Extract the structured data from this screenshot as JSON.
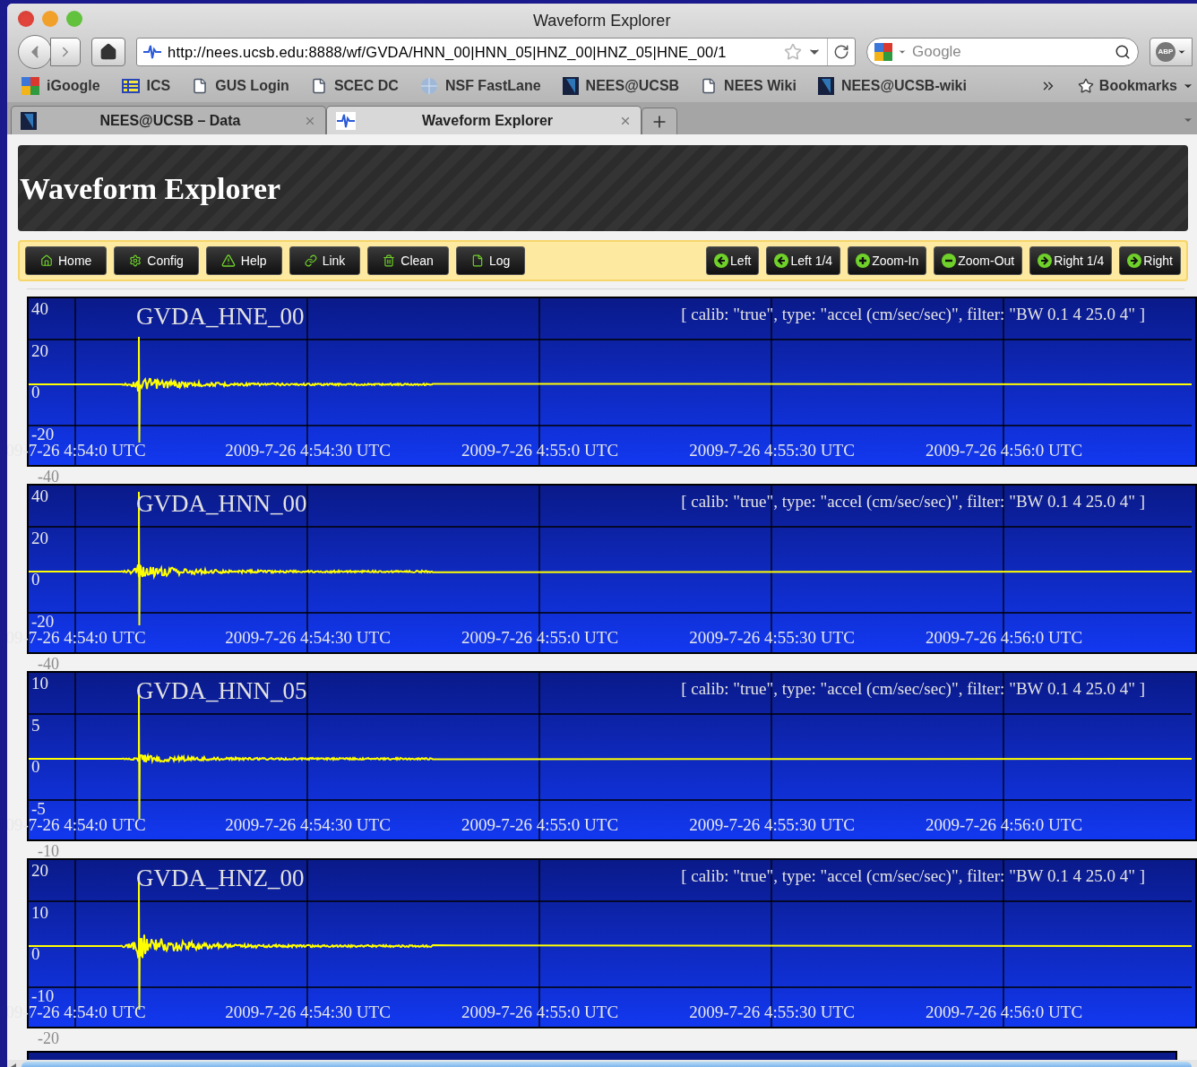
{
  "window": {
    "title": "Waveform Explorer"
  },
  "address_bar": {
    "url": "http://nees.ucsb.edu:8888/wf/GVDA/HNN_00|HNN_05|HNZ_00|HNZ_05|HNE_00/1"
  },
  "search": {
    "placeholder": "Google"
  },
  "abp": {
    "label": "ABP"
  },
  "bookmarks": [
    {
      "label": "iGoogle",
      "kind": "google"
    },
    {
      "label": "ICS",
      "kind": "ics"
    },
    {
      "label": "GUS Login",
      "kind": "page"
    },
    {
      "label": "SCEC DC",
      "kind": "page"
    },
    {
      "label": "NSF FastLane",
      "kind": "globe"
    },
    {
      "label": "NEES@UCSB",
      "kind": "nees"
    },
    {
      "label": "NEES Wiki",
      "kind": "page"
    },
    {
      "label": "NEES@UCSB-wiki",
      "kind": "nees"
    }
  ],
  "bookmarks_menu": {
    "label": "Bookmarks"
  },
  "tabs": [
    {
      "label": "NEES@UCSB – Data",
      "selected": false,
      "kind": "nees"
    },
    {
      "label": "Waveform Explorer",
      "selected": true,
      "kind": "wave"
    }
  ],
  "page": {
    "title": "Waveform Explorer",
    "toolbar_left": [
      {
        "label": "Home",
        "kind": "home"
      },
      {
        "label": "Config",
        "kind": "gear"
      },
      {
        "label": "Help",
        "kind": "warning"
      },
      {
        "label": "Link",
        "kind": "link"
      },
      {
        "label": "Clean",
        "kind": "trash"
      },
      {
        "label": "Log",
        "kind": "page"
      }
    ],
    "toolbar_right": [
      {
        "label": "Left",
        "kind": "left"
      },
      {
        "label": "Left 1/4",
        "kind": "left"
      },
      {
        "label": "Zoom-In",
        "kind": "plus"
      },
      {
        "label": "Zoom-Out",
        "kind": "minus"
      },
      {
        "label": "Right 1/4",
        "kind": "right"
      },
      {
        "label": "Right",
        "kind": "right"
      }
    ],
    "plots": [
      {
        "channel": "GVDA_HNE_00",
        "info": "[ calib: \"true\", type: \"accel (cm/sec/sec)\", filter: \"BW 0.1 4 25.0 4\" ]",
        "y_labels": [
          "40",
          "20",
          "0",
          "-20"
        ],
        "y_below": "-40",
        "x_labels": [
          "09-7-26 4:54:0 UTC",
          "2009-7-26 4:54:30 UTC",
          "2009-7-26 4:55:0 UTC",
          "2009-7-26 4:55:30 UTC",
          "2009-7-26 4:56:0 UTC"
        ]
      },
      {
        "channel": "GVDA_HNN_00",
        "info": "[ calib: \"true\", type: \"accel (cm/sec/sec)\", filter: \"BW 0.1 4 25.0 4\" ]",
        "y_labels": [
          "40",
          "20",
          "0",
          "-20"
        ],
        "y_below": "-40",
        "x_labels": [
          "09-7-26 4:54:0 UTC",
          "2009-7-26 4:54:30 UTC",
          "2009-7-26 4:55:0 UTC",
          "2009-7-26 4:55:30 UTC",
          "2009-7-26 4:56:0 UTC"
        ]
      },
      {
        "channel": "GVDA_HNN_05",
        "info": "[ calib: \"true\", type: \"accel (cm/sec/sec)\", filter: \"BW 0.1 4 25.0 4\" ]",
        "y_labels": [
          "10",
          "5",
          "0",
          "-5"
        ],
        "y_below": "-10",
        "x_labels": [
          "09-7-26 4:54:0 UTC",
          "2009-7-26 4:54:30 UTC",
          "2009-7-26 4:55:0 UTC",
          "2009-7-26 4:55:30 UTC",
          "2009-7-26 4:56:0 UTC"
        ]
      },
      {
        "channel": "GVDA_HNZ_00",
        "info": "[ calib: \"true\", type: \"accel (cm/sec/sec)\", filter: \"BW 0.1 4 25.0 4\" ]",
        "y_labels": [
          "20",
          "10",
          "0",
          "-10"
        ],
        "y_below": "-20",
        "x_labels": [
          "09-7-26 4:54:0 UTC",
          "2009-7-26 4:54:30 UTC",
          "2009-7-26 4:55:0 UTC",
          "2009-7-26 4:55:30 UTC",
          "2009-7-26 4:56:0 UTC"
        ]
      }
    ]
  }
}
